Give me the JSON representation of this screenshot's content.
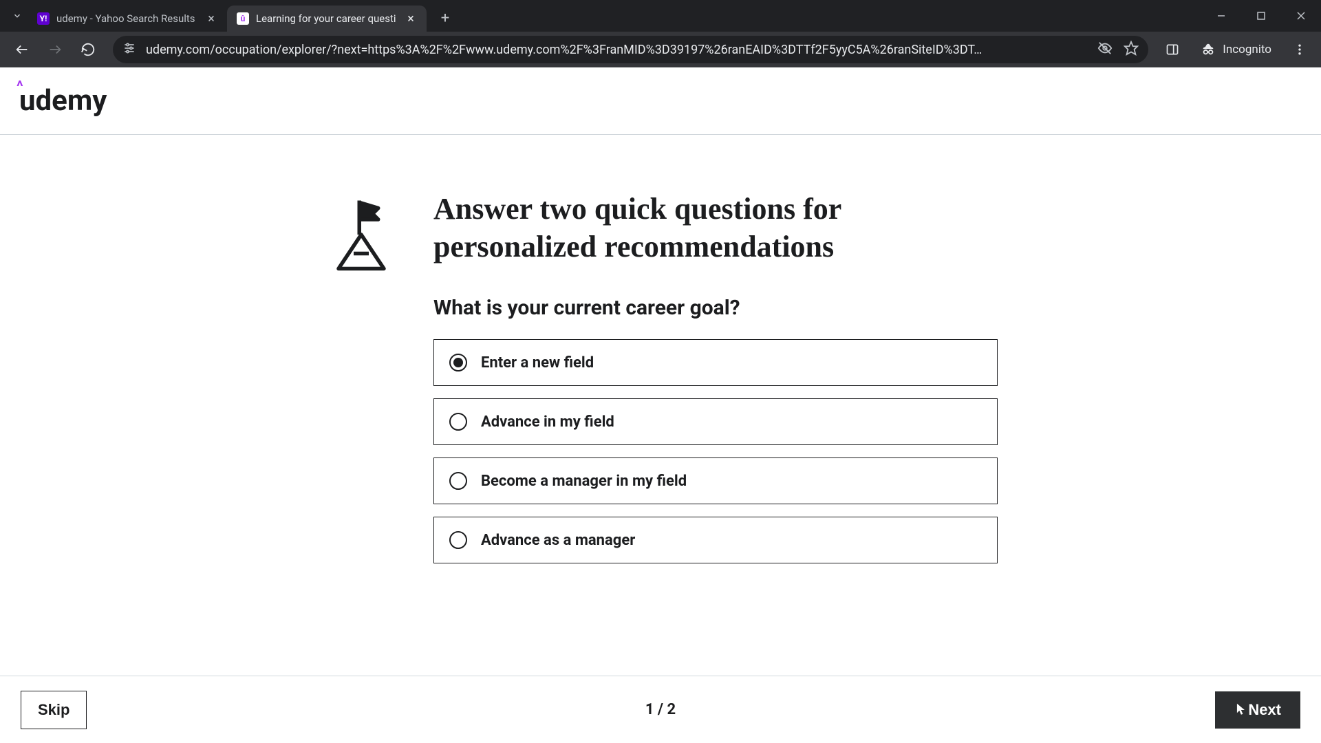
{
  "browser": {
    "tabs": [
      {
        "title": "udemy - Yahoo Search Results",
        "active": false
      },
      {
        "title": "Learning for your career questi",
        "active": true
      }
    ],
    "url": "udemy.com/occupation/explorer/?next=https%3A%2F%2Fwww.udemy.com%2F%3FranMID%3D39197%26ranEAID%3DTTf2F5yyC5A%26ranSiteID%3DT…",
    "incognito_label": "Incognito"
  },
  "header": {
    "brand": "udemy"
  },
  "main": {
    "title": "Answer two quick questions for personalized recommendations",
    "question": "What is your current career goal?",
    "options": [
      {
        "label": "Enter a new field",
        "selected": true
      },
      {
        "label": "Advance in my field",
        "selected": false
      },
      {
        "label": "Become a manager in my field",
        "selected": false
      },
      {
        "label": "Advance as a manager",
        "selected": false
      }
    ]
  },
  "footer": {
    "skip": "Skip",
    "pager": "1 / 2",
    "next": "Next"
  }
}
